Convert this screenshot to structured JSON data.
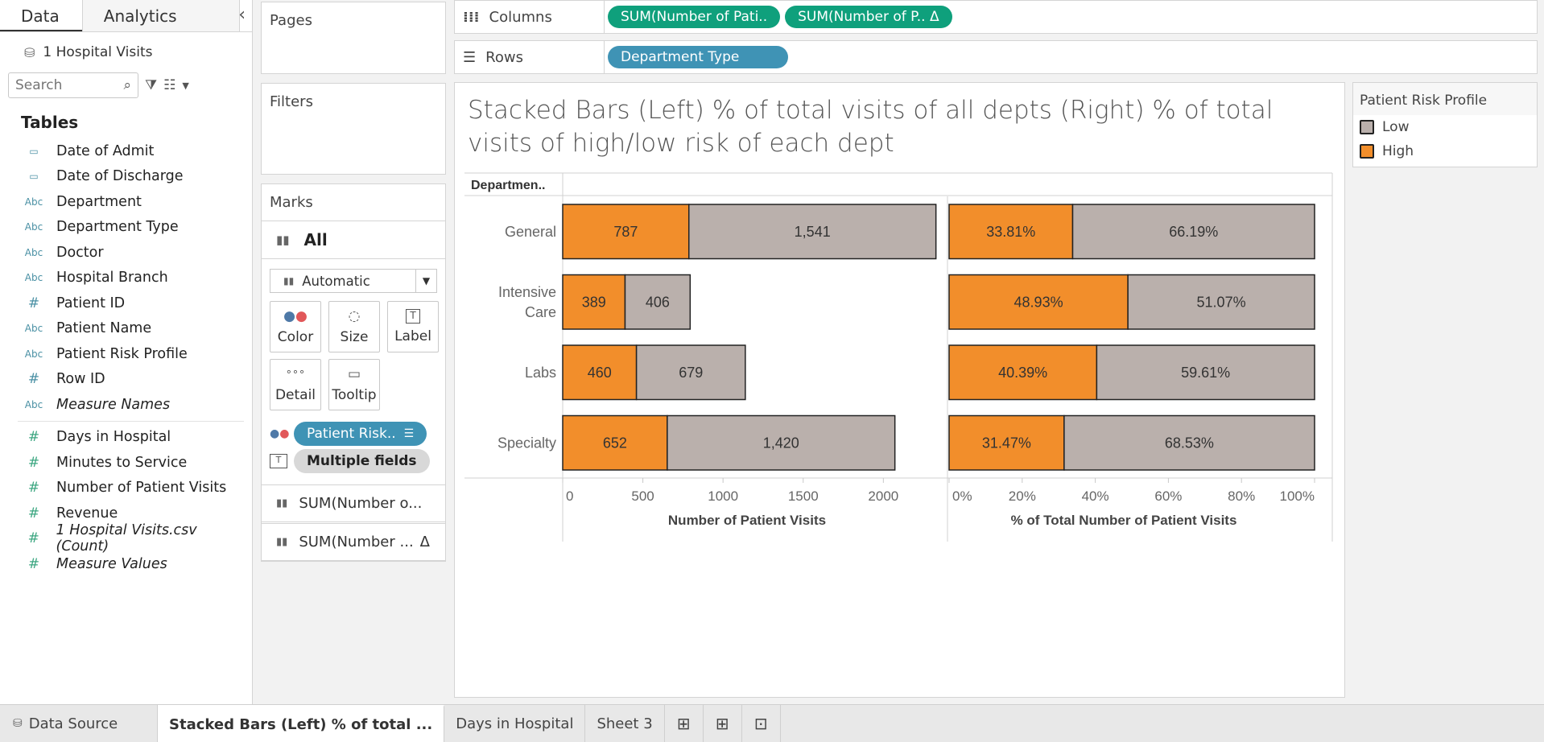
{
  "left_pane": {
    "tab_data": "Data",
    "tab_analytics": "Analytics",
    "datasource": "1 Hospital Visits",
    "search_placeholder": "Search",
    "tables_heading": "Tables",
    "dimensions": [
      {
        "type": "date",
        "name": "Date of Admit"
      },
      {
        "type": "date",
        "name": "Date of Discharge"
      },
      {
        "type": "abc",
        "name": "Department"
      },
      {
        "type": "abc",
        "name": "Department Type"
      },
      {
        "type": "abc",
        "name": "Doctor"
      },
      {
        "type": "abc",
        "name": "Hospital Branch"
      },
      {
        "type": "num",
        "name": "Patient ID"
      },
      {
        "type": "abc",
        "name": "Patient Name"
      },
      {
        "type": "abc",
        "name": "Patient Risk Profile"
      },
      {
        "type": "num",
        "name": "Row ID"
      },
      {
        "type": "abc",
        "name": "Measure Names"
      }
    ],
    "measures": [
      {
        "type": "num",
        "name": "Days in Hospital"
      },
      {
        "type": "num",
        "name": "Minutes to Service"
      },
      {
        "type": "num",
        "name": "Number of Patient Visits"
      },
      {
        "type": "num",
        "name": "Revenue"
      },
      {
        "type": "num",
        "name": "1 Hospital Visits.csv (Count)"
      },
      {
        "type": "num",
        "name": "Measure Values"
      }
    ],
    "type_glyphs": {
      "abc": "Abc",
      "num": "#",
      "date": "▭"
    }
  },
  "cards": {
    "pages": "Pages",
    "filters": "Filters",
    "marks": "Marks",
    "marks_all": "All",
    "mark_type": "Automatic",
    "buttons": {
      "color": "Color",
      "size": "Size",
      "label": "Label",
      "detail": "Detail",
      "tooltip": "Tooltip"
    },
    "color_pill": "Patient Risk..",
    "label_pill": "Multiple fields",
    "measure_card_1": "SUM(Number o...",
    "measure_card_2": "SUM(Number ...",
    "delta_glyph": "Δ"
  },
  "shelves": {
    "columns_label": "Columns",
    "rows_label": "Rows",
    "column_pills": [
      "SUM(Number of Pati..",
      "SUM(Number of P..  Δ"
    ],
    "row_pills": [
      "Department Type"
    ]
  },
  "legend": {
    "title": "Patient Risk Profile",
    "items": [
      {
        "label": "Low",
        "color": "#bab0ac"
      },
      {
        "label": "High",
        "color": "#f28e2b"
      }
    ]
  },
  "bottom_tabs": {
    "data_source": "Data Source",
    "sheets": [
      "Stacked Bars (Left) % of total ...",
      "Days in Hospital",
      "Sheet 3"
    ]
  },
  "chart_data": {
    "type": "bar",
    "title": "Stacked Bars (Left) % of total visits of all depts (Right) % of total visits of high/low risk of each dept",
    "row_header": "Departmen..",
    "categories": [
      "General",
      "Intensive Care",
      "Labs",
      "Specialty"
    ],
    "category_lines": [
      [
        "General"
      ],
      [
        "Intensive",
        "Care"
      ],
      [
        "Labs"
      ],
      [
        "Specialty"
      ]
    ],
    "colors": {
      "High": "#f28e2b",
      "Low": "#bab0ac"
    },
    "left": {
      "xlabel": "Number of Patient Visits",
      "xlim": [
        0,
        2400
      ],
      "ticks": [
        0,
        500,
        1000,
        1500,
        2000
      ],
      "tick_labels": [
        "0",
        "500",
        "1000",
        "1500",
        "2000"
      ],
      "series": [
        {
          "name": "High",
          "values": [
            787,
            389,
            460,
            652
          ],
          "labels": [
            "787",
            "389",
            "460",
            "652"
          ]
        },
        {
          "name": "Low",
          "values": [
            1541,
            406,
            679,
            1420
          ],
          "labels": [
            "1,541",
            "406",
            "679",
            "1,420"
          ]
        }
      ]
    },
    "right": {
      "xlabel": "% of Total Number of Patient Visits",
      "xlim": [
        0,
        100
      ],
      "ticks": [
        0,
        20,
        40,
        60,
        80,
        100
      ],
      "tick_labels": [
        "0%",
        "20%",
        "40%",
        "60%",
        "80%",
        "100%"
      ],
      "series": [
        {
          "name": "High",
          "values": [
            33.81,
            48.93,
            40.39,
            31.47
          ],
          "labels": [
            "33.81%",
            "48.93%",
            "40.39%",
            "31.47%"
          ]
        },
        {
          "name": "Low",
          "values": [
            66.19,
            51.07,
            59.61,
            68.53
          ],
          "labels": [
            "66.19%",
            "51.07%",
            "59.61%",
            "68.53%"
          ]
        }
      ]
    },
    "grid": false
  }
}
